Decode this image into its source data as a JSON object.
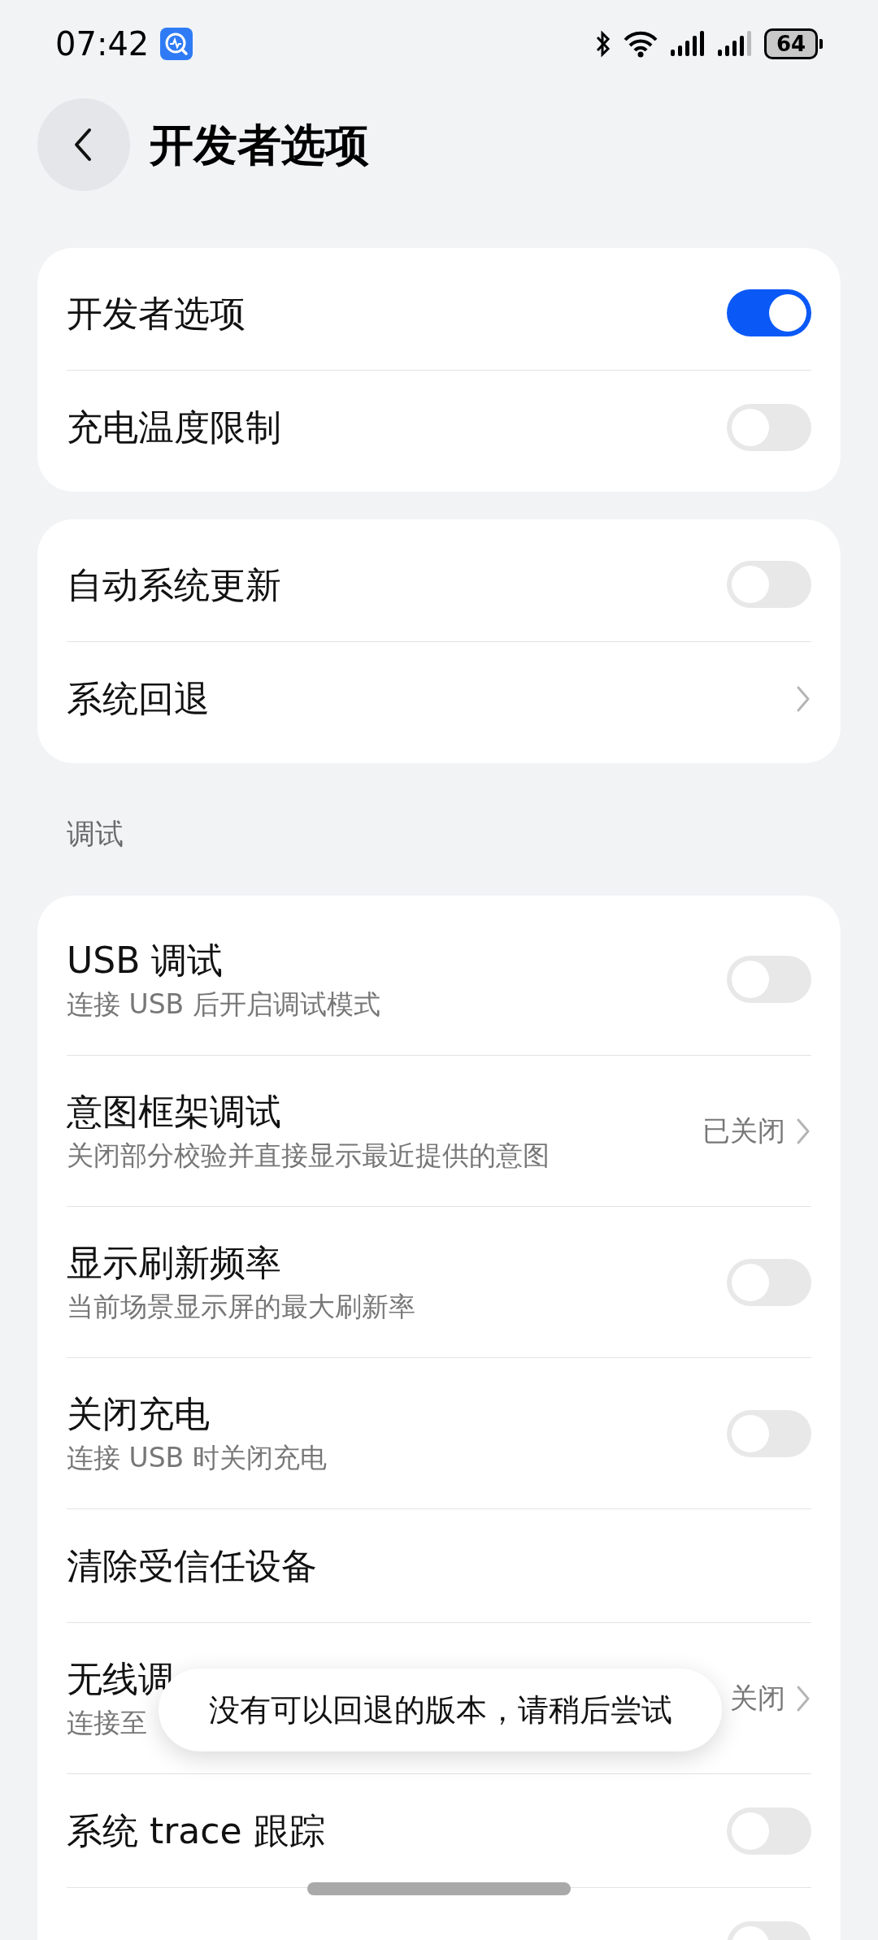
{
  "status_bar": {
    "time": "07:42",
    "battery": "64"
  },
  "header": {
    "title": "开发者选项"
  },
  "groups": [
    {
      "rows": [
        {
          "kind": "toggle",
          "title": "开发者选项",
          "on": true
        },
        {
          "kind": "toggle",
          "title": "充电温度限制",
          "on": false
        }
      ]
    },
    {
      "rows": [
        {
          "kind": "toggle",
          "title": "自动系统更新",
          "on": false
        },
        {
          "kind": "link",
          "title": "系统回退"
        }
      ]
    },
    {
      "label": "调试",
      "rows": [
        {
          "kind": "toggle",
          "title": "USB 调试",
          "subtitle": "连接 USB 后开启调试模式",
          "on": false
        },
        {
          "kind": "link",
          "title": "意图框架调试",
          "subtitle": "关闭部分校验并直接显示最近提供的意图",
          "value": "已关闭"
        },
        {
          "kind": "toggle",
          "title": "显示刷新频率",
          "subtitle": "当前场景显示屏的最大刷新率",
          "on": false
        },
        {
          "kind": "toggle",
          "title": "关闭充电",
          "subtitle": "连接 USB 时关闭充电",
          "on": false
        },
        {
          "kind": "plain",
          "title": "清除受信任设备"
        },
        {
          "kind": "link",
          "title": "无线调",
          "subtitle": "连接至",
          "value": "关闭"
        },
        {
          "kind": "toggle",
          "title": "系统 trace 跟踪",
          "on": false
        },
        {
          "kind": "toggle",
          "on": false
        }
      ]
    }
  ],
  "toast": {
    "text": "没有可以回退的版本，请稍后尝试"
  }
}
